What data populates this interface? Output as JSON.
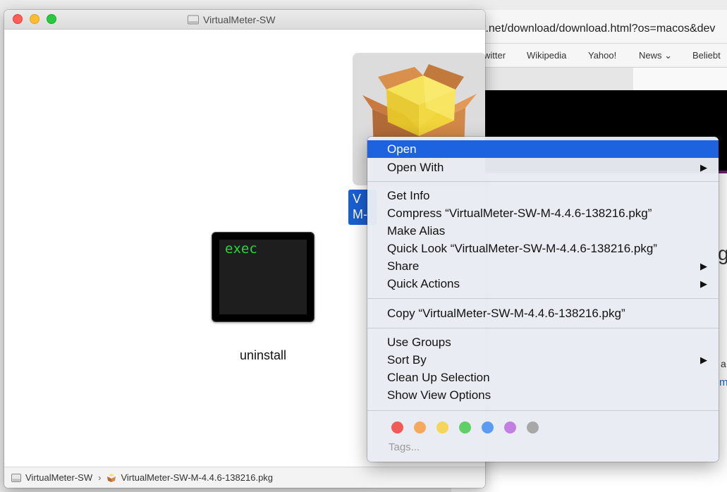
{
  "finder": {
    "title": "VirtualMeter-SW",
    "exec_icon_text": "exec",
    "uninstall_label": "uninstall",
    "pkg_label_partial": "V M-",
    "pathbar": {
      "crumb1": "VirtualMeter-SW",
      "crumb2": "VirtualMeter-SW-M-4.4.6-138216.pkg"
    }
  },
  "browser": {
    "url_fragment": "t.net/download/download.html?os=macos&dev",
    "bookmarks": [
      "witter",
      "Wikipedia",
      "Yahoo!",
      "News ⌄",
      "Beliebt"
    ],
    "frag_g": "g",
    "frag_a": "a",
    "frag_m": "m"
  },
  "context_menu": {
    "items": [
      {
        "label": "Open",
        "highlighted": true
      },
      {
        "label": "Open With",
        "submenu": true
      },
      {
        "label": "Get Info"
      },
      {
        "label": "Compress “VirtualMeter-SW-M-4.4.6-138216.pkg”"
      },
      {
        "label": "Make Alias"
      },
      {
        "label": "Quick Look “VirtualMeter-SW-M-4.4.6-138216.pkg”"
      },
      {
        "label": "Share",
        "submenu": true
      },
      {
        "label": "Quick Actions",
        "submenu": true
      },
      {
        "label": "Copy “VirtualMeter-SW-M-4.4.6-138216.pkg”"
      },
      {
        "label": "Use Groups"
      },
      {
        "label": "Sort By",
        "submenu": true
      },
      {
        "label": "Clean Up Selection"
      },
      {
        "label": "Show View Options"
      }
    ],
    "submenu_arrow": "▶",
    "tag_colors": [
      "#f25a55",
      "#f6a95a",
      "#f5d55a",
      "#5fcf66",
      "#5b9cf2",
      "#c27ee2",
      "#a8a8a8"
    ],
    "tags_label": "Tags..."
  },
  "colors": {
    "highlight": "#1d63e0",
    "selection": "#1a5fd1"
  }
}
